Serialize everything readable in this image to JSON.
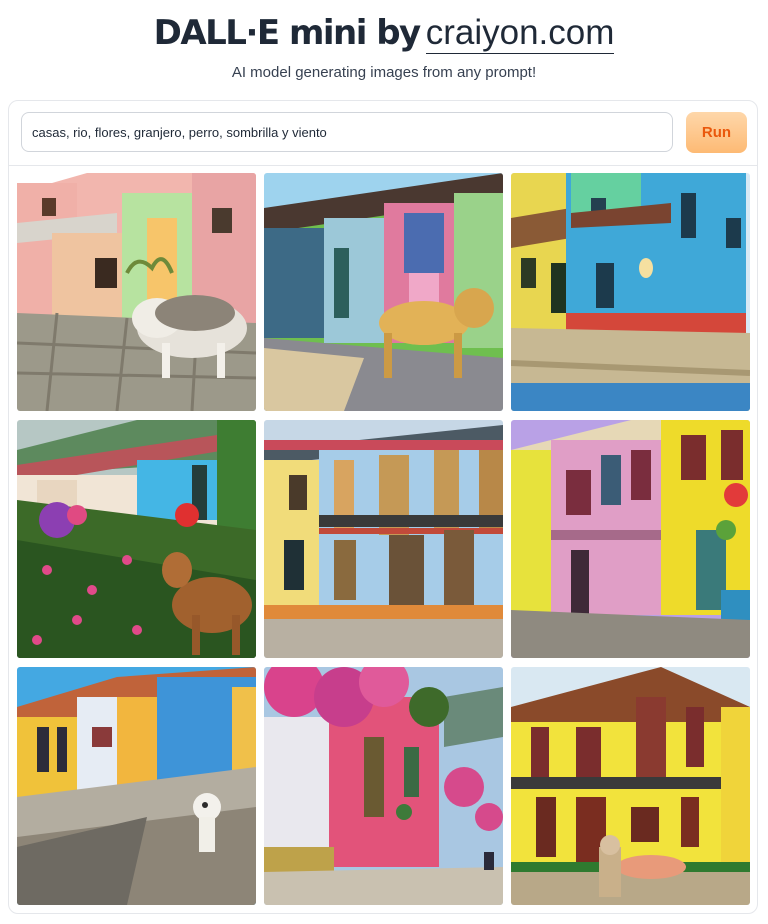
{
  "header": {
    "title_main": "DALL·E mini by",
    "title_link": "craiyon.com",
    "subtitle": "AI model generating images from any prompt!"
  },
  "prompt": {
    "value": "casas, rio, flores, granjero, perro, sombrilla y viento",
    "run_label": "Run"
  },
  "results": [
    {
      "name": "result-image-1"
    },
    {
      "name": "result-image-2"
    },
    {
      "name": "result-image-3"
    },
    {
      "name": "result-image-4"
    },
    {
      "name": "result-image-5"
    },
    {
      "name": "result-image-6"
    },
    {
      "name": "result-image-7"
    },
    {
      "name": "result-image-8"
    },
    {
      "name": "result-image-9"
    }
  ],
  "colors": {
    "run_bg": "#fdba74",
    "run_text": "#ea580c",
    "title": "#1f2937"
  }
}
